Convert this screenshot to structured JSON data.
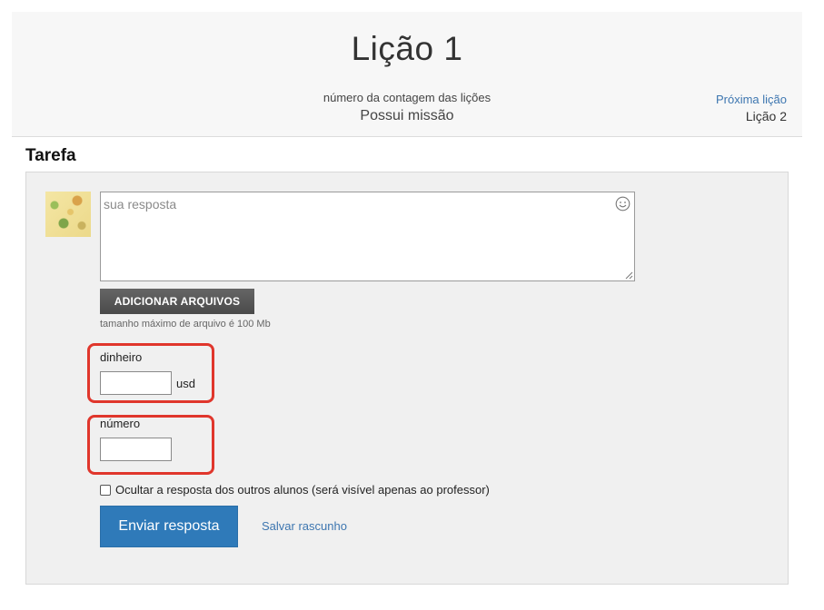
{
  "header": {
    "lesson_title": "Lição 1",
    "count_label": "número da contagem das lições",
    "mission_text": "Possui missão",
    "next_link": "Próxima lição",
    "next_lesson_name": "Lição 2"
  },
  "task": {
    "heading": "Tarefa",
    "answer_placeholder": "sua resposta",
    "upload_label": "ADICIONAR ARQUIVOS",
    "file_size_note": "tamanho máximo de arquivo é 100 Mb",
    "fields": {
      "money_label": "dinheiro",
      "money_value": "",
      "money_unit": "usd",
      "number_label": "número",
      "number_value": ""
    },
    "hide_answer_label": "Ocultar a resposta dos outros alunos (será visível apenas ao professor)",
    "hide_answer_checked": false,
    "submit_label": "Enviar resposta",
    "draft_label": "Salvar rascunho"
  },
  "colors": {
    "accent": "#2f7ab9",
    "link": "#3d76b0",
    "highlight": "#e0362c",
    "panel_bg": "#f0f0f0"
  },
  "icons": [
    "smiley-icon",
    "resize-grip-icon",
    "avatar-image"
  ]
}
